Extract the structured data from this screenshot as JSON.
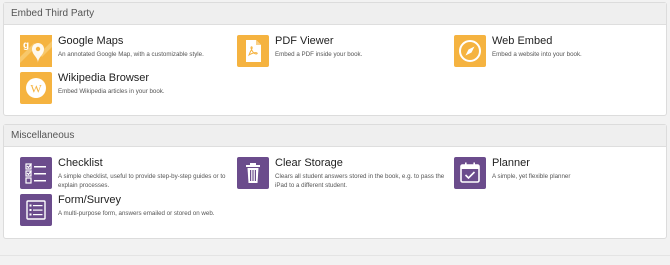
{
  "sections": [
    {
      "header": "Embed Third Party",
      "widgets": [
        {
          "title": "Google Maps",
          "desc": "An annotated Google Map, with a customizable style.",
          "icon": "google-maps-icon",
          "color": "#f5b340"
        },
        {
          "title": "PDF Viewer",
          "desc": "Embed a PDF inside your book.",
          "icon": "pdf-document-icon",
          "color": "#f5b340"
        },
        {
          "title": "Web Embed",
          "desc": "Embed a website into your book.",
          "icon": "compass-icon",
          "color": "#f5b340"
        },
        {
          "title": "Wikipedia Browser",
          "desc": "Embed Wikipedia articles in your book.",
          "icon": "wikipedia-icon",
          "color": "#f5b340"
        }
      ]
    },
    {
      "header": "Miscellaneous",
      "widgets": [
        {
          "title": "Checklist",
          "desc": "A simple checklist, useful to provide step-by-step guides or to explain processes.",
          "icon": "checklist-icon",
          "color": "#6b4c8c"
        },
        {
          "title": "Clear Storage",
          "desc": "Clears all student answers stored in the book, e.g. to pass the iPad to a different student.",
          "icon": "trash-icon",
          "color": "#6b4c8c"
        },
        {
          "title": "Planner",
          "desc": "A simple, yet flexible planner",
          "icon": "calendar-icon",
          "color": "#6b4c8c"
        },
        {
          "title": "Form/Survey",
          "desc": "A multi-purpose form, answers emailed or stored on web.",
          "icon": "form-list-icon",
          "color": "#6b4c8c"
        }
      ]
    }
  ]
}
